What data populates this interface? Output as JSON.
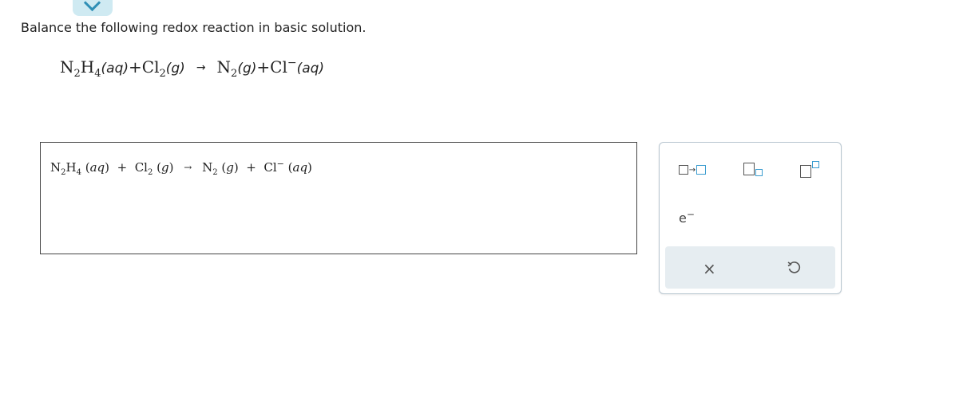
{
  "question": {
    "prompt": "Balance the following redox reaction in basic solution."
  },
  "reaction": {
    "r1_elem1": "N",
    "r1_sub1": "2",
    "r1_elem2": "H",
    "r1_sub2": "4",
    "r1_state": "(aq)",
    "plus1": "+",
    "r2_elem": "Cl",
    "r2_sub": "2",
    "r2_state": "(g)",
    "arrow": "→",
    "p1_elem": "N",
    "p1_sub": "2",
    "p1_state": "(g)",
    "plus2": "+",
    "p2_elem": "Cl",
    "p2_charge": "−",
    "p2_state": "(aq)"
  },
  "answer": {
    "r1_elem1": "N",
    "r1_sub1": "2",
    "r1_elem2": "H",
    "r1_sub2": "4",
    "r1_state_open": "(",
    "r1_state": "aq",
    "r1_state_close": ")",
    "plus1": "+",
    "r2_elem": "Cl",
    "r2_sub": "2",
    "r2_state_open": "(",
    "r2_state": "g",
    "r2_state_close": ")",
    "arrow": "→",
    "p1_elem": "N",
    "p1_sub": "2",
    "p1_state_open": "(",
    "p1_state": "g",
    "p1_state_close": ")",
    "plus2": "+",
    "p2_elem": "Cl",
    "p2_charge": "−",
    "p2_state_open": "(",
    "p2_state": "aq",
    "p2_state_close": ")"
  },
  "palette": {
    "arrow_glyph": "→",
    "electron_symbol": "e",
    "electron_charge": "−",
    "clear_glyph": "×",
    "accent_color": "#3a9ccf",
    "action_bar_color": "#e6edf1"
  },
  "icons": [
    "chevron-down-icon",
    "reaction-arrow-icon",
    "subscript-icon",
    "superscript-icon",
    "electron-icon",
    "clear-icon",
    "undo-icon"
  ]
}
